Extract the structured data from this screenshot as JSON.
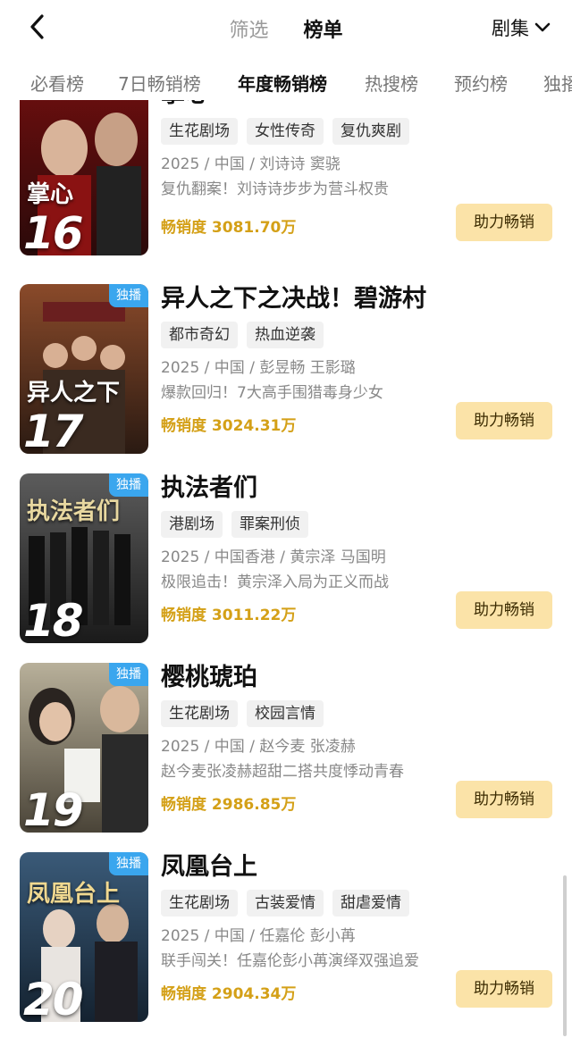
{
  "header": {
    "filter_label": "筛选",
    "ranking_label": "榜单",
    "category_label": "剧集"
  },
  "tabs": [
    "必看榜",
    "7日畅销榜",
    "年度畅销榜",
    "热搜榜",
    "预约榜",
    "独播"
  ],
  "active_tab_index": 2,
  "items": [
    {
      "rank": "16",
      "title": "掌心",
      "tags": [
        "生花剧场",
        "女性传奇",
        "复仇爽剧"
      ],
      "meta": "2025 / 中国 / 刘诗诗  窦骁",
      "desc": "复仇翻案！刘诗诗步步为营斗权贵",
      "sales": "畅销度 3081.70万",
      "button": "助力畅销",
      "badge": "",
      "poster_text": "掌心",
      "poster_colors": [
        "#6b0e0e",
        "#2a0a0a"
      ]
    },
    {
      "rank": "17",
      "title": "异人之下之决战！碧游村",
      "tags": [
        "都市奇幻",
        "热血逆袭"
      ],
      "meta": "2025 / 中国 / 彭昱畅  王影璐",
      "desc": "爆款回归！7大高手围猎毒身少女",
      "sales": "畅销度 3024.31万",
      "button": "助力畅销",
      "badge": "独播",
      "poster_text": "异人之下",
      "poster_colors": [
        "#8a4a2a",
        "#2a1a12"
      ]
    },
    {
      "rank": "18",
      "title": "执法者们",
      "tags": [
        "港剧场",
        "罪案刑侦"
      ],
      "meta": "2025 / 中国香港 / 黄宗泽  马国明",
      "desc": "极限追击！黄宗泽入局为正义而战",
      "sales": "畅销度 3011.22万",
      "button": "助力畅销",
      "badge": "独播",
      "poster_text": "执法者们",
      "poster_colors": [
        "#5c5c5c",
        "#1a1a1a"
      ]
    },
    {
      "rank": "19",
      "title": "樱桃琥珀",
      "tags": [
        "生花剧场",
        "校园言情"
      ],
      "meta": "2025 / 中国 / 赵今麦  张凌赫",
      "desc": "赵今麦张凌赫超甜二搭共度悸动青春",
      "sales": "畅销度 2986.85万",
      "button": "助力畅销",
      "badge": "独播",
      "poster_text": "樱桃琥珀",
      "poster_colors": [
        "#b8b09a",
        "#4a4438"
      ]
    },
    {
      "rank": "20",
      "title": "凤凰台上",
      "tags": [
        "生花剧场",
        "古装爱情",
        "甜虐爱情"
      ],
      "meta": "2025 / 中国 / 任嘉伦  彭小苒",
      "desc": "联手闯关！任嘉伦彭小苒演绎双强追爱",
      "sales": "畅销度 2904.34万",
      "button": "助力畅销",
      "badge": "独播",
      "poster_text": "凤凰台上",
      "poster_colors": [
        "#3a5a78",
        "#142230"
      ]
    }
  ],
  "colors": {
    "sales": "#d4a017",
    "button_bg": "#fbe3a8",
    "badge": "#3aa6ee"
  }
}
